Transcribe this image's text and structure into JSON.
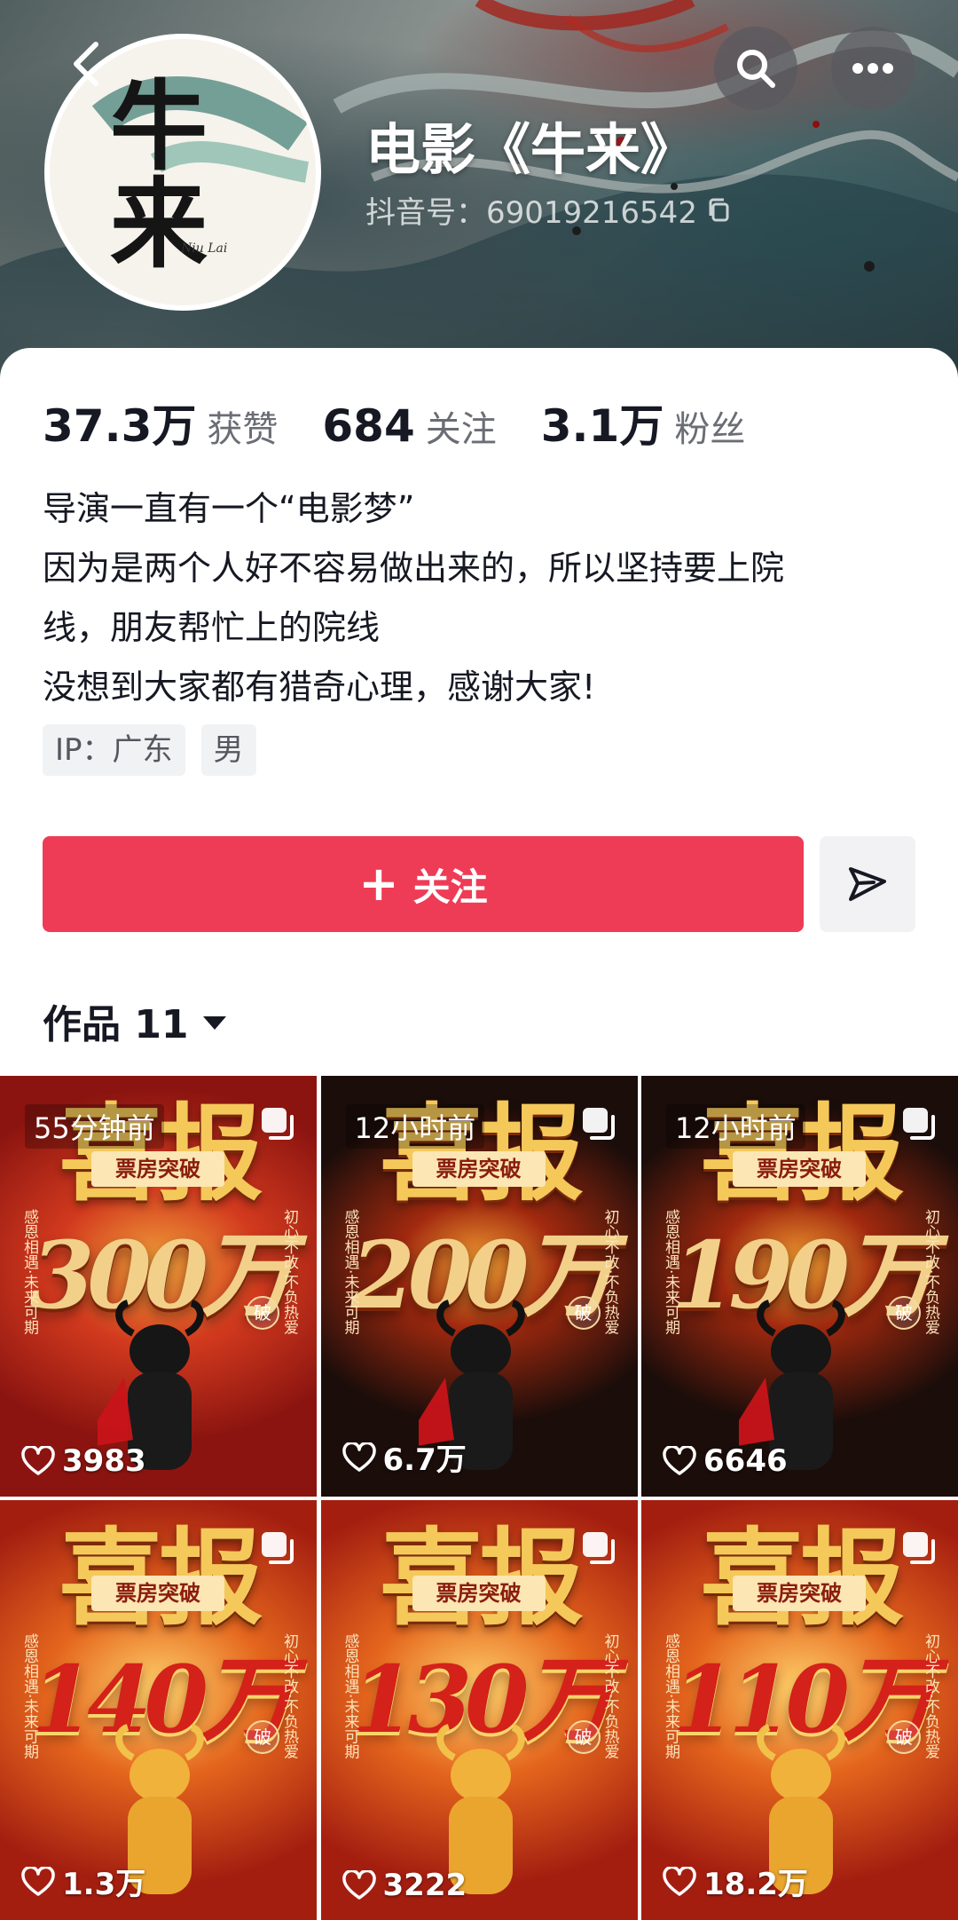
{
  "header": {
    "name": "电影《牛来》",
    "douyin_id": "抖音号：69019216542",
    "avatar_title": "牛来",
    "avatar_subtitle": "Niu Lai"
  },
  "stats": [
    {
      "value": "37.3万",
      "label": "获赞"
    },
    {
      "value": "684",
      "label": "关注"
    },
    {
      "value": "3.1万",
      "label": "粉丝"
    }
  ],
  "bio": [
    "导演一直有一个“电影梦”",
    "因为是两个人好不容易做出来的，所以坚持要上院",
    "线，朋友帮忙上的院线",
    "没想到大家都有猎奇心理，感谢大家!"
  ],
  "tags": [
    "IP：广东",
    "男"
  ],
  "follow_button": "关注",
  "works_tab": "作品 11",
  "posts": [
    {
      "time": "55分钟前",
      "headline": "喜报",
      "banner": "票房突破",
      "amount": "300万",
      "likes": "3983",
      "theme": "red"
    },
    {
      "time": "12小时前",
      "headline": "喜报",
      "banner": "票房突破",
      "amount": "200万",
      "likes": "6.7万",
      "theme": "dark"
    },
    {
      "time": "12小时前",
      "headline": "喜报",
      "banner": "票房突破",
      "amount": "190万",
      "likes": "6646",
      "theme": "dark"
    },
    {
      "time": "",
      "headline": "喜报",
      "banner": "票房突破",
      "amount": "140万",
      "likes": "1.3万",
      "theme": "gold"
    },
    {
      "time": "",
      "headline": "喜报",
      "banner": "票房突破",
      "amount": "130万",
      "likes": "3222",
      "theme": "gold"
    },
    {
      "time": "",
      "headline": "喜报",
      "banner": "票房突破",
      "amount": "110万",
      "likes": "18.2万",
      "theme": "gold"
    }
  ],
  "poster_side_text": {
    "left": "感恩相遇·未来可期",
    "right": "初心不改·不负热爱",
    "seal": "破"
  },
  "colors": {
    "follow_button": "#ee3c56",
    "text_primary": "#161823",
    "text_secondary": "#6b6d75"
  }
}
